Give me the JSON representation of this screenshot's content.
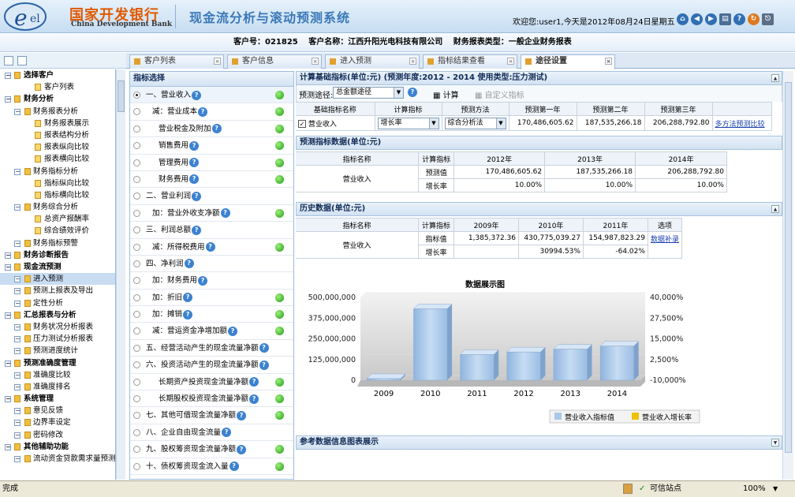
{
  "header": {
    "bank_cn": "国家开发银行",
    "bank_en": "China Development Bank",
    "system_title": "现金流分析与滚动预测系统",
    "welcome": "欢迎您:user1,今天是2012年08月24日星期五",
    "icons": [
      "home-icon",
      "back-icon",
      "forward-icon",
      "book-icon",
      "help-icon",
      "refresh-icon",
      "exit-icon"
    ]
  },
  "infobar": {
    "customer_no": "客户号：021825",
    "customer_name": "客户名称：江西升阳光电科技有限公司",
    "report_type": "财务报表类型：一般企业财务报表"
  },
  "sidebar": {
    "items": [
      {
        "label": "选择客户",
        "level": 0
      },
      {
        "label": "客户列表",
        "level": 2
      },
      {
        "label": "财务分析",
        "level": 0
      },
      {
        "label": "财务报表分析",
        "level": 1
      },
      {
        "label": "财务报表展示",
        "level": 2
      },
      {
        "label": "报表结构分析",
        "level": 2
      },
      {
        "label": "报表纵向比较",
        "level": 2
      },
      {
        "label": "报表横向比较",
        "level": 2
      },
      {
        "label": "财务指标分析",
        "level": 1
      },
      {
        "label": "指标纵向比较",
        "level": 2
      },
      {
        "label": "指标横向比较",
        "level": 2
      },
      {
        "label": "财务综合分析",
        "level": 1
      },
      {
        "label": "总资产报酬率",
        "level": 2
      },
      {
        "label": "综合绩效评价",
        "level": 2
      },
      {
        "label": "财务指标预警",
        "level": 1
      },
      {
        "label": "财务诊断报告",
        "level": 0
      },
      {
        "label": "现金流预测",
        "level": 0
      },
      {
        "label": "进入预测",
        "level": 1,
        "selected": true
      },
      {
        "label": "预测上报表及导出",
        "level": 1
      },
      {
        "label": "定性分析",
        "level": 1
      },
      {
        "label": "汇总报表与分析",
        "level": 0
      },
      {
        "label": "财务状况分析报表",
        "level": 1
      },
      {
        "label": "压力测试分析报表",
        "level": 1
      },
      {
        "label": "预测进度统计",
        "level": 1
      },
      {
        "label": "预测准确度管理",
        "level": 0
      },
      {
        "label": "准确度比较",
        "level": 1
      },
      {
        "label": "准确度排名",
        "level": 1
      },
      {
        "label": "系统管理",
        "level": 0
      },
      {
        "label": "意见反馈",
        "level": 1
      },
      {
        "label": "边界率设定",
        "level": 1
      },
      {
        "label": "密码修改",
        "level": 1
      },
      {
        "label": "其他辅助功能",
        "level": 0
      },
      {
        "label": "流动资金贷款需求量预测",
        "level": 1
      }
    ]
  },
  "tabs": [
    {
      "label": "客户列表",
      "active": false
    },
    {
      "label": "客户信息",
      "active": false
    },
    {
      "label": "进入预测",
      "active": false
    },
    {
      "label": "指标结果查看",
      "active": false
    },
    {
      "label": "途径设置",
      "active": true
    }
  ],
  "indicator_panel": {
    "title": "指标选择",
    "items": [
      {
        "label": "一、营业收入",
        "selected": true,
        "help": true,
        "dot": true
      },
      {
        "label": "减：营业成本",
        "help": true,
        "dot": true
      },
      {
        "label": "营业税金及附加",
        "help": true,
        "dot": true
      },
      {
        "label": "销售费用",
        "help": true,
        "dot": true
      },
      {
        "label": "管理费用",
        "help": true,
        "dot": true
      },
      {
        "label": "财务费用",
        "help": true,
        "dot": true
      },
      {
        "label": "二、营业利润",
        "help": true,
        "dot": false
      },
      {
        "label": "加：营业外收支净额",
        "help": true,
        "dot": true
      },
      {
        "label": "三、利润总额",
        "help": true,
        "dot": false
      },
      {
        "label": "减：所得税费用",
        "help": true,
        "dot": true
      },
      {
        "label": "四、净利润",
        "help": true,
        "dot": false
      },
      {
        "label": "加：财务费用",
        "help": true,
        "dot": false
      },
      {
        "label": "加：折旧",
        "help": true,
        "dot": true
      },
      {
        "label": "加：摊销",
        "help": true,
        "dot": true
      },
      {
        "label": "减：营运资金净增加额",
        "help": true,
        "dot": true
      },
      {
        "label": "五、经营活动产生的现金流量净额",
        "help": true,
        "dot": false
      },
      {
        "label": "六、投资活动产生的现金流量净额",
        "help": true,
        "dot": false
      },
      {
        "label": "长期资产投资现金流量净额",
        "help": true,
        "dot": true
      },
      {
        "label": "长期股权投资现金流量净额",
        "help": true,
        "dot": true
      },
      {
        "label": "七、其他可借现金流量净额",
        "help": true,
        "dot": true
      },
      {
        "label": "八、企业自由现金流量",
        "help": true,
        "dot": false
      },
      {
        "label": "九、股权筹资现金流量净额",
        "help": true,
        "dot": true
      },
      {
        "label": "十、债权筹资现金流入量",
        "help": true,
        "dot": true
      }
    ]
  },
  "calc": {
    "title": "计算基础指标(单位:元)    (预测年度:2012 - 2014    使用类型:压力测试)",
    "path_label": "预测途径:",
    "path_value": "总金额途径",
    "calc_btn": "计算",
    "custom_btn": "自定义指标",
    "headers": [
      "基础指标名称",
      "计算指标",
      "预测方法",
      "预测第一年",
      "预测第二年",
      "预测第三年"
    ],
    "row": {
      "name": "营业收入",
      "calc": "增长率",
      "method": "综合分析法",
      "y1": "170,486,605.62",
      "y2": "187,535,266.18",
      "y3": "206,288,792.80",
      "link": "多方法预测比较"
    }
  },
  "forecast": {
    "title": "预测指标数据(单位:元)",
    "headers": [
      "指标名称",
      "计算指标",
      "2012年",
      "2013年",
      "2014年"
    ],
    "name": "营业收入",
    "rows": [
      {
        "label": "预测值",
        "values": [
          "170,486,605.62",
          "187,535,266.18",
          "206,288,792.80"
        ]
      },
      {
        "label": "增长率",
        "values": [
          "10.00%",
          "10.00%",
          "10.00%"
        ]
      }
    ]
  },
  "history": {
    "title": "历史数据(单位:元)",
    "headers": [
      "指标名称",
      "计算指标",
      "2009年",
      "2010年",
      "2011年",
      "选项"
    ],
    "name": "营业收入",
    "rows": [
      {
        "label": "指标值",
        "values": [
          "1,385,372.36",
          "430,775,039.27",
          "154,987,823.29"
        ]
      },
      {
        "label": "增长率",
        "values": [
          "",
          "30994.53%",
          "-64.02%"
        ]
      }
    ],
    "link": "数据补录"
  },
  "chart_data": {
    "type": "bar",
    "title": "数据展示图",
    "categories": [
      "2009",
      "2010",
      "2011",
      "2012",
      "2013",
      "2014"
    ],
    "series": [
      {
        "name": "营业收入指标值",
        "values": [
          1385372.36,
          430775039.27,
          154987823.29,
          170486605.62,
          187535266.18,
          206288792.8
        ],
        "color": "#a9c8ea"
      },
      {
        "name": "营业收入增长率",
        "values": [
          null,
          30994.53,
          -64.02,
          10,
          10,
          10
        ],
        "color": "#f0c000"
      }
    ],
    "yticks_left": [
      "500,000,000",
      "375,000,000",
      "250,000,000",
      "125,000,000",
      "0"
    ],
    "yticks_right": [
      "40,000%",
      "27,500%",
      "15,000%",
      "2,500%",
      "-10,000%"
    ],
    "ylim": [
      0,
      500000000
    ],
    "legend": "bottom-center"
  },
  "ref": {
    "title": "参考数据信息图表展示"
  },
  "status": {
    "left": "完成",
    "zone": "可信站点",
    "zoom": "100%"
  }
}
